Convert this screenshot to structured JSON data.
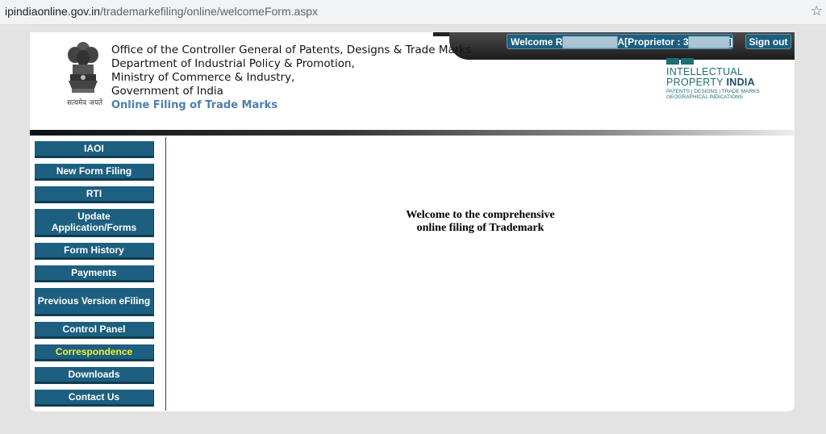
{
  "browser": {
    "url_domain": "ipindiaonline.gov.in",
    "url_path": "/trademarkefiling/online/welcomeForm.aspx"
  },
  "header": {
    "office_line1": "Office of the Controller General of Patents, Designs & Trade Marks",
    "office_line2": "Department of Industrial Policy & Promotion,",
    "office_line3": "Ministry of Commerce & Industry,",
    "office_line4": "Government of India",
    "subtitle": "Online Filing of Trade Marks",
    "emblem_caption": "सत्यमेव जयते",
    "welcome_prefix": "Welcome R",
    "welcome_suffix": "A[Proprietor : 3",
    "welcome_end": "]",
    "signout_label": "Sign out",
    "logo_line1": "INTELLECTUAL",
    "logo_line2a": "PROPERTY ",
    "logo_line2b": "INDIA",
    "logo_line3": "PATENTS | DESIGNS | TRADE MARKS",
    "logo_line4": "GEOGRAPHICAL INDICATIONS"
  },
  "sidebar": {
    "items": [
      {
        "label": "IAOI"
      },
      {
        "label": "New Form Filing"
      },
      {
        "label": "RTI"
      },
      {
        "label": "Update Application/Forms"
      },
      {
        "label": "Form History"
      },
      {
        "label": "Payments"
      },
      {
        "label": "Previous Version eFiling"
      },
      {
        "label": "Control Panel"
      },
      {
        "label": "Correspondence"
      },
      {
        "label": "Downloads"
      },
      {
        "label": "Contact Us"
      }
    ],
    "active_item": "Correspondence"
  },
  "main": {
    "welcome_line1": "Welcome to the comprehensive",
    "welcome_line2": "online filing of Trademark"
  },
  "colors": {
    "nav_button": "#1d5f80",
    "active_text": "#f5f02a",
    "subtitle": "#4a7fb3"
  },
  "icons": {
    "star": "bookmark-star-icon",
    "emblem": "state-emblem-icon"
  }
}
